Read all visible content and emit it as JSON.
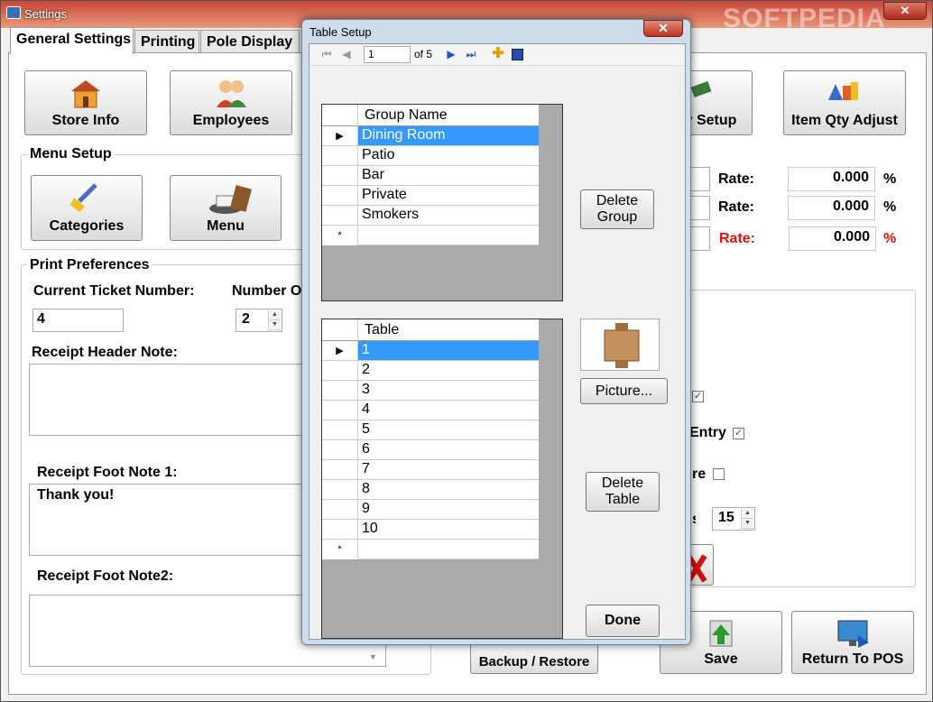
{
  "main_window": {
    "title": "Settings",
    "watermark": "SOFTPEDIA"
  },
  "tabs": [
    "General Settings",
    "Printing",
    "Pole Display"
  ],
  "top_buttons": {
    "store_info": "Store Info",
    "employees": "Employees",
    "qty_setup": "y Setup",
    "item_qty_adjust": "Item Qty Adjust"
  },
  "menu_setup": {
    "title": "Menu Setup",
    "categories": "Categories",
    "menu": "Menu"
  },
  "tax": {
    "rate_label": "Rate:",
    "rates": [
      "0.000",
      "0.000",
      "0.000"
    ],
    "percent": "%",
    "highlight_color": "#e01010"
  },
  "print_prefs": {
    "title": "Print Preferences",
    "current_ticket_label": "Current Ticket Number:",
    "current_ticket_value": "4",
    "number_of_label": "Number O",
    "number_of_value": "2",
    "receipt_header_label": "Receipt Header Note:",
    "foot_note1_label": "Receipt Foot Note 1:",
    "foot_note1_value": "Thank you!",
    "foot_note2_label": "Receipt Foot Note2:"
  },
  "right_panel": {
    "entry_label": "Entry",
    "re_label": "re",
    "spin_value": "15"
  },
  "bottom_buttons": {
    "backup_restore": "Backup / Restore",
    "save": "Save",
    "return_to_pos": "Return To POS"
  },
  "dialog": {
    "title": "Table Setup",
    "close": "✕",
    "nav": {
      "position": "1",
      "of_count": "of 5"
    },
    "group_grid": {
      "header": "Group Name",
      "rows": [
        "Dining Room",
        "Patio",
        "Bar",
        "Private",
        "Smokers"
      ]
    },
    "delete_group": [
      "Delete",
      "Group"
    ],
    "picture_button": "Picture...",
    "table_grid": {
      "header": "Table",
      "rows": [
        "1",
        "2",
        "3",
        "4",
        "5",
        "6",
        "7",
        "8",
        "9",
        "10"
      ]
    },
    "delete_table": [
      "Delete",
      "Table"
    ],
    "done": "Done"
  }
}
